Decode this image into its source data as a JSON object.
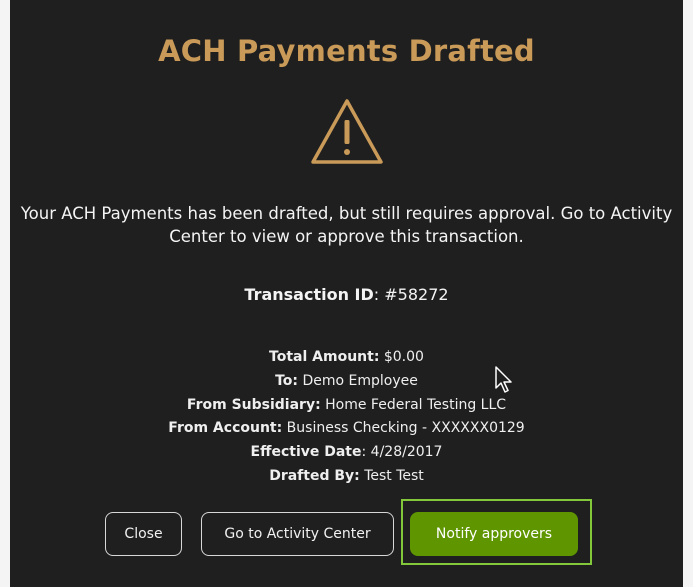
{
  "title": "ACH Payments Drafted",
  "icons": {
    "warning": "warning-triangle-icon",
    "cursor": "pointer-cursor-icon"
  },
  "message": "Your ACH Payments has been drafted, but still requires approval. Go to Activity Center to view or approve this transaction.",
  "transaction": {
    "label": "Transaction ID",
    "value": ": #58272"
  },
  "details": [
    {
      "label": "Total Amount:",
      "value": " $0.00"
    },
    {
      "label": "To:",
      "value": " Demo Employee"
    },
    {
      "label": "From Subsidiary:",
      "value": " Home Federal Testing LLC"
    },
    {
      "label": "From Account:",
      "value": " Business Checking - XXXXXX0129"
    },
    {
      "label": "Effective Date",
      "value": ": 4/28/2017"
    },
    {
      "label": "Drafted By:",
      "value": " Test Test"
    }
  ],
  "buttons": {
    "close": "Close",
    "activity": "Go to Activity Center",
    "notify": "Notify approvers"
  },
  "colors": {
    "title": "#c99a58",
    "accent_green": "#5f9600",
    "focus_ring": "#83c73a",
    "modal_bg": "#1f1f1f"
  }
}
